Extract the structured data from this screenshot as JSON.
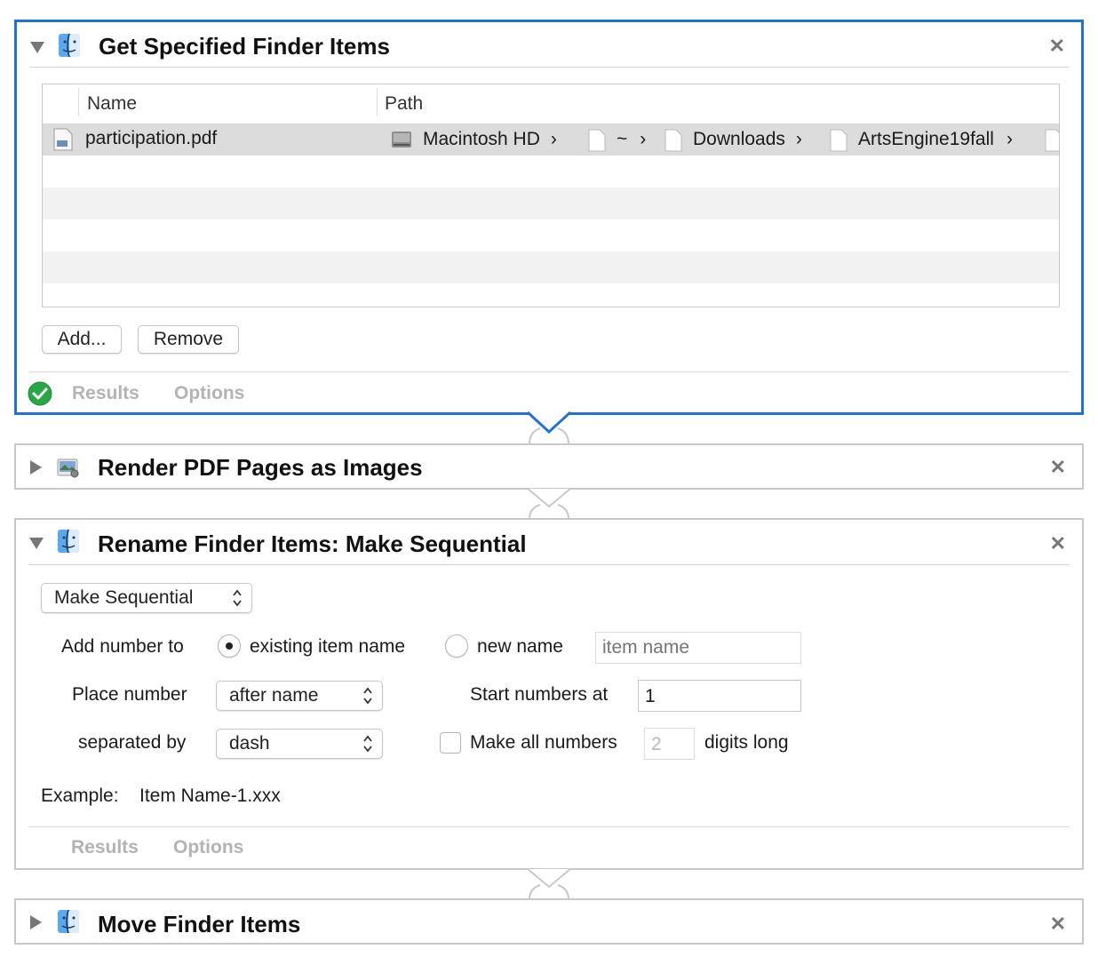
{
  "actions": [
    {
      "title": "Get Specified Finder Items",
      "table": {
        "columns": [
          "Name",
          "Path"
        ],
        "rows": [
          {
            "name": "participation.pdf",
            "path": [
              "Macintosh HD",
              "~",
              "Downloads",
              "ArtsEngine19fall"
            ]
          }
        ]
      },
      "buttons": {
        "add": "Add...",
        "remove": "Remove"
      },
      "tabs": {
        "results": "Results",
        "options": "Options"
      }
    },
    {
      "title": "Render PDF Pages as Images"
    },
    {
      "title": "Rename Finder Items: Make Sequential",
      "mode_popup": "Make Sequential",
      "add_number_to_label": "Add number to",
      "radio_existing": "existing item name",
      "radio_new": "new name",
      "new_name_placeholder": "item name",
      "place_number_label": "Place number",
      "place_number_value": "after name",
      "start_numbers_label": "Start numbers at",
      "start_numbers_value": "1",
      "separated_by_label": "separated by",
      "separated_by_value": "dash",
      "make_all_label": "Make all numbers",
      "digits_value": "2",
      "digits_long_label": "digits long",
      "example_label": "Example:",
      "example_value": "Item Name-1.xxx",
      "tabs": {
        "results": "Results",
        "options": "Options"
      }
    },
    {
      "title": "Move Finder Items"
    }
  ],
  "colors": {
    "selection_border": "#1f74d3",
    "success_green": "#28a745",
    "tab_text": "#b3b3b3"
  }
}
